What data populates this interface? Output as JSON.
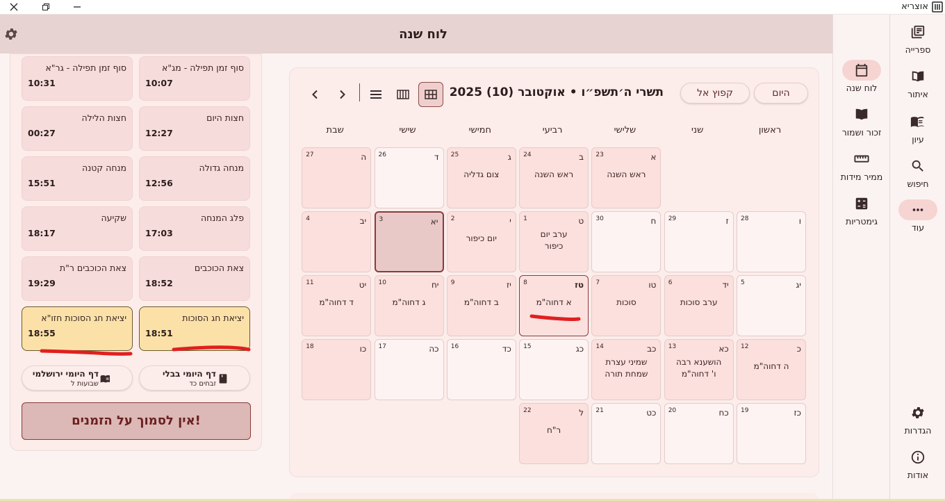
{
  "app": {
    "title": "אוצריא"
  },
  "rail": [
    {
      "label": "ספרייה",
      "icon": "library-icon"
    },
    {
      "label": "איתור",
      "icon": "book-open-icon"
    },
    {
      "label": "עיון",
      "icon": "book-reader-icon"
    },
    {
      "label": "חיפוש",
      "icon": "search-icon"
    },
    {
      "label": "עוד",
      "icon": "more-icon"
    },
    {
      "label": "הגדרות",
      "icon": "gear-icon"
    },
    {
      "label": "אודות",
      "icon": "info-icon"
    }
  ],
  "subrail": [
    {
      "label": "לוח שנה",
      "icon": "calendar-icon"
    },
    {
      "label": "זכור ושמור",
      "icon": "book-icon"
    },
    {
      "label": "ממיר מידות",
      "icon": "ruler-icon"
    },
    {
      "label": "גימטריות",
      "icon": "calculator-icon"
    }
  ],
  "page": {
    "title": "לוח שנה"
  },
  "calendar": {
    "today_label": "היום",
    "jump_label": "קפוץ אל",
    "month_title": "תשרי ה׳תשפ״ו • אוקטובר (10) 2025",
    "weekdays": [
      "ראשון",
      "שני",
      "שלישי",
      "רביעי",
      "חמישי",
      "שישי",
      "שבת"
    ],
    "days": [
      {
        "heb": "א",
        "greg": "23",
        "event": "ראש השנה",
        "row": 0,
        "col": 2,
        "style": "event"
      },
      {
        "heb": "ב",
        "greg": "24",
        "event": "ראש השנה",
        "row": 0,
        "col": 3,
        "style": "event"
      },
      {
        "heb": "ג",
        "greg": "25",
        "event": "צום גדליה",
        "row": 0,
        "col": 4,
        "style": "event"
      },
      {
        "heb": "ד",
        "greg": "26",
        "event": "",
        "row": 0,
        "col": 5,
        "style": ""
      },
      {
        "heb": "ה",
        "greg": "27",
        "event": "",
        "row": 0,
        "col": 6,
        "style": "event"
      },
      {
        "heb": "ו",
        "greg": "28",
        "event": "",
        "row": 1,
        "col": 0,
        "style": ""
      },
      {
        "heb": "ז",
        "greg": "29",
        "event": "",
        "row": 1,
        "col": 1,
        "style": ""
      },
      {
        "heb": "ח",
        "greg": "30",
        "event": "",
        "row": 1,
        "col": 2,
        "style": ""
      },
      {
        "heb": "ט",
        "greg": "1",
        "event": "ערב יום כיפור",
        "row": 1,
        "col": 3,
        "style": "event"
      },
      {
        "heb": "י",
        "greg": "2",
        "event": "יום כיפור",
        "row": 1,
        "col": 4,
        "style": "event"
      },
      {
        "heb": "יא",
        "greg": "3",
        "event": "",
        "row": 1,
        "col": 5,
        "style": "selected"
      },
      {
        "heb": "יב",
        "greg": "4",
        "event": "",
        "row": 1,
        "col": 6,
        "style": "event"
      },
      {
        "heb": "יג",
        "greg": "5",
        "event": "",
        "row": 2,
        "col": 0,
        "style": ""
      },
      {
        "heb": "יד",
        "greg": "6",
        "event": "ערב סוכות",
        "row": 2,
        "col": 1,
        "style": "event"
      },
      {
        "heb": "טו",
        "greg": "7",
        "event": "סוכות",
        "row": 2,
        "col": 2,
        "style": "event"
      },
      {
        "heb": "טז",
        "greg": "8",
        "event": "א דחוה\"מ",
        "row": 2,
        "col": 3,
        "style": "today"
      },
      {
        "heb": "יז",
        "greg": "9",
        "event": "ב דחוה\"מ",
        "row": 2,
        "col": 4,
        "style": "event"
      },
      {
        "heb": "יח",
        "greg": "10",
        "event": "ג דחוה\"מ",
        "row": 2,
        "col": 5,
        "style": "event"
      },
      {
        "heb": "יט",
        "greg": "11",
        "event": "ד דחוה\"מ",
        "row": 2,
        "col": 6,
        "style": "event"
      },
      {
        "heb": "כ",
        "greg": "12",
        "event": "ה דחוה\"מ",
        "row": 3,
        "col": 0,
        "style": "event"
      },
      {
        "heb": "כא",
        "greg": "13",
        "event": "הושענא רבה ו' דחוה\"מ",
        "row": 3,
        "col": 1,
        "style": "event"
      },
      {
        "heb": "כב",
        "greg": "14",
        "event": "שמיני עצרת שמחת תורה",
        "row": 3,
        "col": 2,
        "style": "event"
      },
      {
        "heb": "כג",
        "greg": "15",
        "event": "",
        "row": 3,
        "col": 3,
        "style": ""
      },
      {
        "heb": "כד",
        "greg": "16",
        "event": "",
        "row": 3,
        "col": 4,
        "style": ""
      },
      {
        "heb": "כה",
        "greg": "17",
        "event": "",
        "row": 3,
        "col": 5,
        "style": ""
      },
      {
        "heb": "כו",
        "greg": "18",
        "event": "",
        "row": 3,
        "col": 6,
        "style": "event"
      },
      {
        "heb": "כז",
        "greg": "19",
        "event": "",
        "row": 4,
        "col": 0,
        "style": ""
      },
      {
        "heb": "כח",
        "greg": "20",
        "event": "",
        "row": 4,
        "col": 1,
        "style": ""
      },
      {
        "heb": "כט",
        "greg": "21",
        "event": "",
        "row": 4,
        "col": 2,
        "style": ""
      },
      {
        "heb": "ל",
        "greg": "22",
        "event": "ר\"ח",
        "row": 4,
        "col": 3,
        "style": "event"
      }
    ]
  },
  "zmanim": [
    {
      "name": "סוף זמן תפילה - מג\"א",
      "time": "10:07",
      "highlight": false
    },
    {
      "name": "סוף זמן תפילה - גר\"א",
      "time": "10:31",
      "highlight": false
    },
    {
      "name": "חצות היום",
      "time": "12:27",
      "highlight": false
    },
    {
      "name": "חצות הלילה",
      "time": "00:27",
      "highlight": false
    },
    {
      "name": "מנחה גדולה",
      "time": "12:56",
      "highlight": false
    },
    {
      "name": "מנחה קטנה",
      "time": "15:51",
      "highlight": false
    },
    {
      "name": "פלג המנחה",
      "time": "17:03",
      "highlight": false
    },
    {
      "name": "שקיעה",
      "time": "18:17",
      "highlight": false
    },
    {
      "name": "צאת הכוכבים",
      "time": "18:52",
      "highlight": false
    },
    {
      "name": "צאת הכוכבים ר\"ת",
      "time": "19:29",
      "highlight": false
    },
    {
      "name": "יציאת חג הסוכות",
      "time": "18:51",
      "highlight": true
    },
    {
      "name": "יציאת חג הסוכות חזו\"א",
      "time": "18:55",
      "highlight": true
    }
  ],
  "daf": {
    "bavli": {
      "title": "דף היומי בבלי",
      "sub": "זבחים כד"
    },
    "yerushalmi": {
      "title": "דף היומי ירושלמי",
      "sub": "שבועות ל"
    }
  },
  "warning": "אין לסמוך על הזמנים!",
  "colors": {
    "accent": "#8a3a3a",
    "highlight": "#fbe1a8",
    "annotation": "#e02020"
  }
}
